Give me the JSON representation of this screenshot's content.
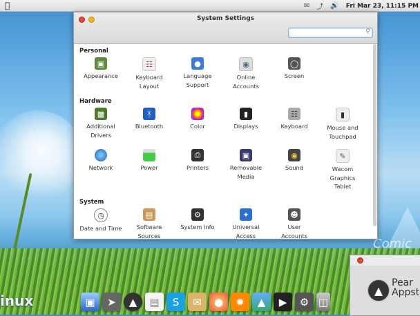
{
  "topbar": {
    "clock": "Fri Mar 23, 11:15 PM",
    "tray_icons": [
      "mail-icon",
      "network-icon",
      "volume-icon"
    ]
  },
  "wallpaper": {
    "brand_partial": "inux",
    "comic_partial": "Comic"
  },
  "window": {
    "title": "System Settings",
    "search": {
      "value": "",
      "placeholder": ""
    },
    "sections": [
      {
        "title": "Personal",
        "items": [
          {
            "label": "Appearance",
            "icon": "appearance-icon"
          },
          {
            "label": "Keyboard Layout",
            "icon": "keyboard-layout-icon"
          },
          {
            "label": "Language Support",
            "icon": "language-support-icon"
          },
          {
            "label": "Online Accounts",
            "icon": "online-accounts-icon"
          },
          {
            "label": "Screen",
            "icon": "screen-icon"
          }
        ]
      },
      {
        "title": "Hardware",
        "items": [
          {
            "label": "Additional Drivers",
            "icon": "additional-drivers-icon"
          },
          {
            "label": "Bluetooth",
            "icon": "bluetooth-icon"
          },
          {
            "label": "Color",
            "icon": "color-icon"
          },
          {
            "label": "Displays",
            "icon": "displays-icon"
          },
          {
            "label": "Keyboard",
            "icon": "keyboard-icon"
          },
          {
            "label": "Mouse and Touchpad",
            "icon": "mouse-icon"
          },
          {
            "label": "Network",
            "icon": "network-icon"
          },
          {
            "label": "Power",
            "icon": "power-icon"
          },
          {
            "label": "Printers",
            "icon": "printer-icon"
          },
          {
            "label": "Removable Media",
            "icon": "removable-media-icon"
          },
          {
            "label": "Sound",
            "icon": "sound-icon"
          },
          {
            "label": "Wacom Graphics Tablet",
            "icon": "wacom-tablet-icon"
          }
        ]
      },
      {
        "title": "System",
        "items": [
          {
            "label": "Date and Time",
            "icon": "clock-icon"
          },
          {
            "label": "Software Sources",
            "icon": "software-sources-icon"
          },
          {
            "label": "System Info",
            "icon": "system-info-icon"
          },
          {
            "label": "Universal Access",
            "icon": "universal-access-icon"
          },
          {
            "label": "User Accounts",
            "icon": "user-accounts-icon"
          }
        ]
      }
    ]
  },
  "dock": [
    "finder-icon",
    "launchpad-icon",
    "appstore-icon",
    "document-icon",
    "skype-icon",
    "mail-icon",
    "firefox-icon",
    "burst-icon",
    "photos-icon",
    "video-icon",
    "settings-icon",
    "trash-icon"
  ],
  "second_window": {
    "title_line1": "Pear",
    "title_line2": "Appst"
  },
  "colors": {
    "accent": "#3b7dd8",
    "close": "#e2463a",
    "minimize": "#f0b429"
  }
}
